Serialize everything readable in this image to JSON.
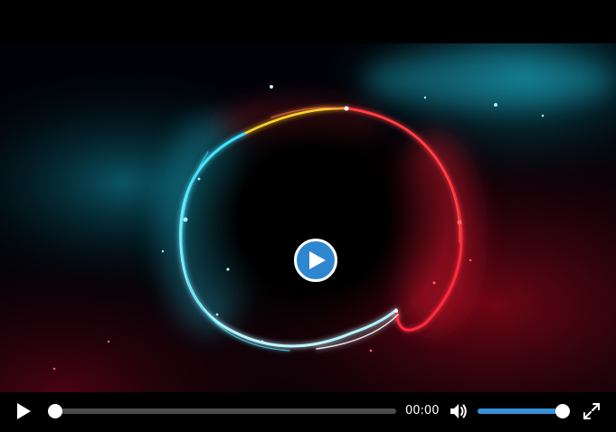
{
  "video": {
    "scene_description_icon": "glowing-ring-icon",
    "big_play_icon": "play-circle-icon"
  },
  "controls": {
    "play_icon": "play-icon",
    "current_time": "00:00",
    "progress_fraction": 0,
    "mute_icon": "volume-icon",
    "volume_fraction": 1,
    "fullscreen_icon": "fullscreen-icon"
  },
  "colors": {
    "accent": "#3a90d6",
    "track": "#4b4b4b",
    "background": "#000000"
  }
}
